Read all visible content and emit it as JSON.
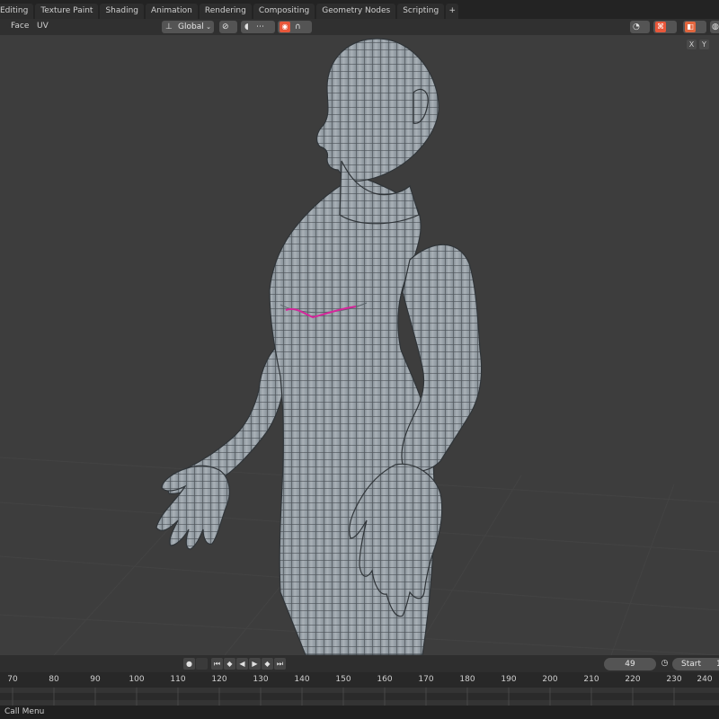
{
  "workspace_tabs": [
    "Editing",
    "Texture Paint",
    "Shading",
    "Animation",
    "Rendering",
    "Compositing",
    "Geometry Nodes",
    "Scripting"
  ],
  "add_tab_label": "+",
  "header": {
    "menu_face": "Face",
    "menu_uv": "UV",
    "orientation": "Global"
  },
  "viewport": {
    "axis_x": "X",
    "axis_y": "Y"
  },
  "playback": {
    "current_frame": "49",
    "start_label": "Start",
    "start_value": "1"
  },
  "ruler_ticks": [
    "70",
    "80",
    "90",
    "100",
    "110",
    "120",
    "130",
    "140",
    "150",
    "160",
    "170",
    "180",
    "190",
    "200",
    "210",
    "220",
    "230",
    "240"
  ],
  "status": {
    "left": "Call Menu"
  },
  "colors": {
    "selected_edge": "#d6259b",
    "snapping_active": "#e8573a",
    "shading_solid": "#e2663e"
  }
}
